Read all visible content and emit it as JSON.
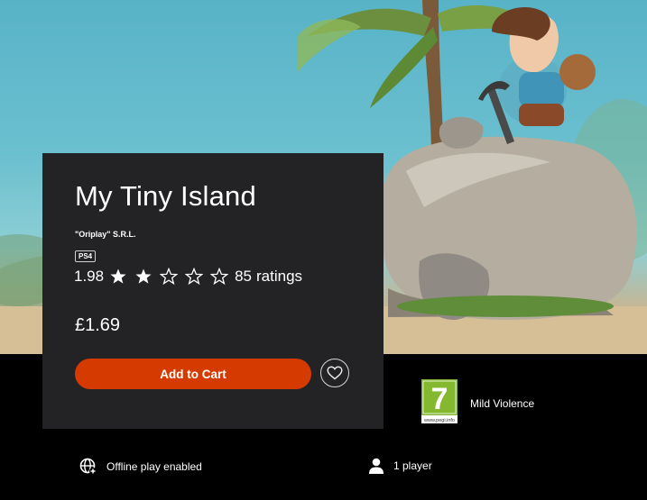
{
  "game": {
    "title": "My Tiny Island",
    "publisher": "\"Oriplay\" S.R.L.",
    "platform": "PS4",
    "rating_value": "1.98",
    "rating_score": 1.98,
    "rating_max": 5,
    "filled_stars": 2,
    "ratings_count": "85",
    "ratings_suffix": "ratings",
    "price": "£1.69"
  },
  "actions": {
    "add_to_cart_label": "Add to Cart",
    "wishlist_icon": "heart-icon"
  },
  "age_rating": {
    "value": "7",
    "url_text": "www.pegi.info",
    "descriptor": "Mild Violence",
    "color": "#84b82e"
  },
  "features": [
    {
      "icon": "globe-icon",
      "label": "Offline play enabled"
    },
    {
      "icon": "person-icon",
      "label": "1 player"
    }
  ],
  "colors": {
    "cart_button": "#d53b00",
    "card_background": "#232326",
    "page_background": "#000000"
  }
}
